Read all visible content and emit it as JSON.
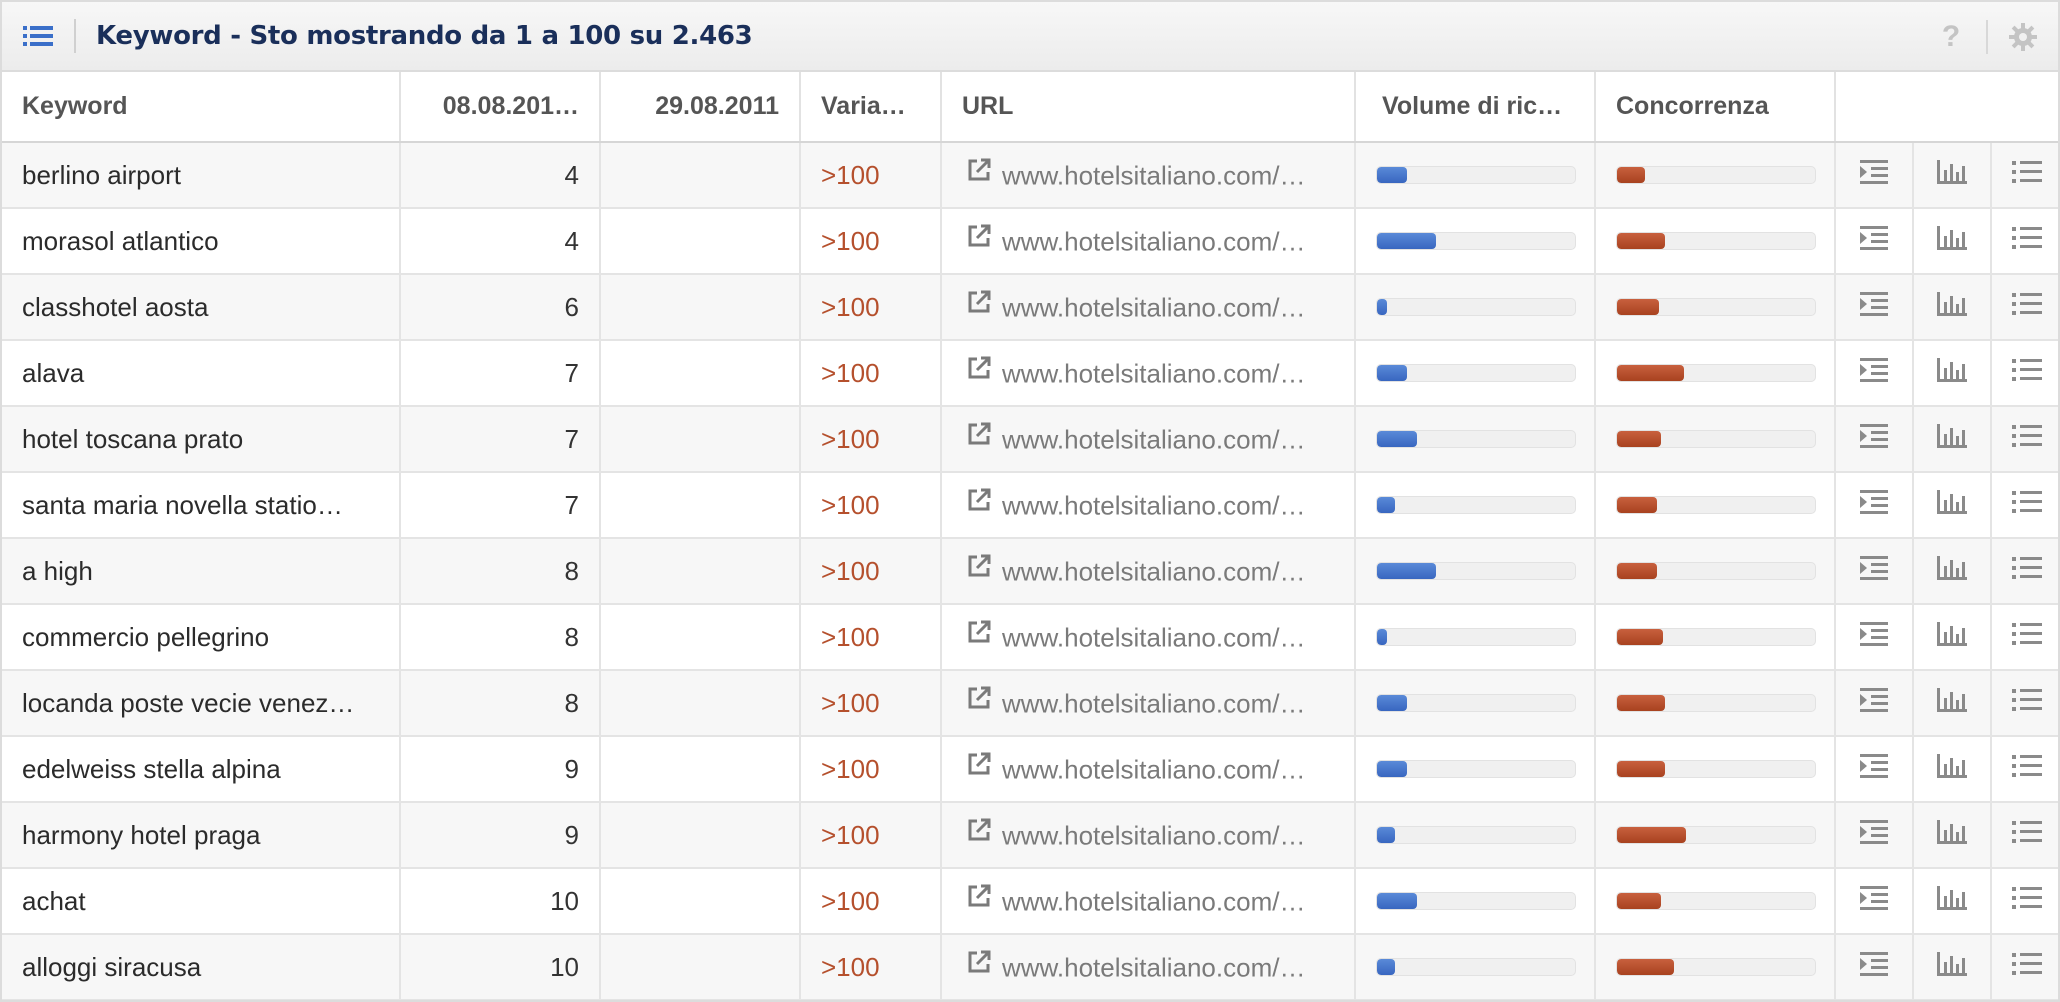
{
  "header": {
    "title": "Keyword - Sto mostrando da 1 a 100 su 2.463",
    "help_label": "?",
    "menu_icon": "list-icon",
    "settings_icon": "gear-icon"
  },
  "columns": {
    "keyword": "Keyword",
    "date1": "08.08.201…",
    "date2": "29.08.2011",
    "variation": "Varia…",
    "url": "URL",
    "volume": "Volume di ric…",
    "competition": "Concorrenza"
  },
  "colors": {
    "accent_blue": "#3866c0",
    "accent_red": "#b5502d",
    "title_navy": "#1a2f5a"
  },
  "rows": [
    {
      "keyword": "berlino airport",
      "pos": "4",
      "pos2": "",
      "change": ">100",
      "url": "www.hotelsitaliano.com/…",
      "volume": 0.15,
      "competition": 0.14
    },
    {
      "keyword": "morasol atlantico",
      "pos": "4",
      "pos2": "",
      "change": ">100",
      "url": "www.hotelsitaliano.com/…",
      "volume": 0.3,
      "competition": 0.24
    },
    {
      "keyword": "classhotel aosta",
      "pos": "6",
      "pos2": "",
      "change": ">100",
      "url": "www.hotelsitaliano.com/…",
      "volume": 0.05,
      "competition": 0.21
    },
    {
      "keyword": "alava",
      "pos": "7",
      "pos2": "",
      "change": ">100",
      "url": "www.hotelsitaliano.com/…",
      "volume": 0.15,
      "competition": 0.34
    },
    {
      "keyword": "hotel toscana prato",
      "pos": "7",
      "pos2": "",
      "change": ">100",
      "url": "www.hotelsitaliano.com/…",
      "volume": 0.2,
      "competition": 0.22
    },
    {
      "keyword": "santa maria novella statio…",
      "pos": "7",
      "pos2": "",
      "change": ">100",
      "url": "www.hotelsitaliano.com/…",
      "volume": 0.09,
      "competition": 0.2
    },
    {
      "keyword": "a high",
      "pos": "8",
      "pos2": "",
      "change": ">100",
      "url": "www.hotelsitaliano.com/…",
      "volume": 0.3,
      "competition": 0.2
    },
    {
      "keyword": "commercio pellegrino",
      "pos": "8",
      "pos2": "",
      "change": ">100",
      "url": "www.hotelsitaliano.com/…",
      "volume": 0.05,
      "competition": 0.23
    },
    {
      "keyword": "locanda poste vecie venez…",
      "pos": "8",
      "pos2": "",
      "change": ">100",
      "url": "www.hotelsitaliano.com/…",
      "volume": 0.15,
      "competition": 0.24
    },
    {
      "keyword": "edelweiss stella alpina",
      "pos": "9",
      "pos2": "",
      "change": ">100",
      "url": "www.hotelsitaliano.com/…",
      "volume": 0.15,
      "competition": 0.24
    },
    {
      "keyword": "harmony hotel praga",
      "pos": "9",
      "pos2": "",
      "change": ">100",
      "url": "www.hotelsitaliano.com/…",
      "volume": 0.09,
      "competition": 0.35
    },
    {
      "keyword": "achat",
      "pos": "10",
      "pos2": "",
      "change": ">100",
      "url": "www.hotelsitaliano.com/…",
      "volume": 0.2,
      "competition": 0.22
    },
    {
      "keyword": "alloggi siracusa",
      "pos": "10",
      "pos2": "",
      "change": ">100",
      "url": "www.hotelsitaliano.com/…",
      "volume": 0.09,
      "competition": 0.29
    }
  ],
  "row_actions": [
    "indent-list-icon",
    "bar-chart-icon",
    "list-icon"
  ]
}
